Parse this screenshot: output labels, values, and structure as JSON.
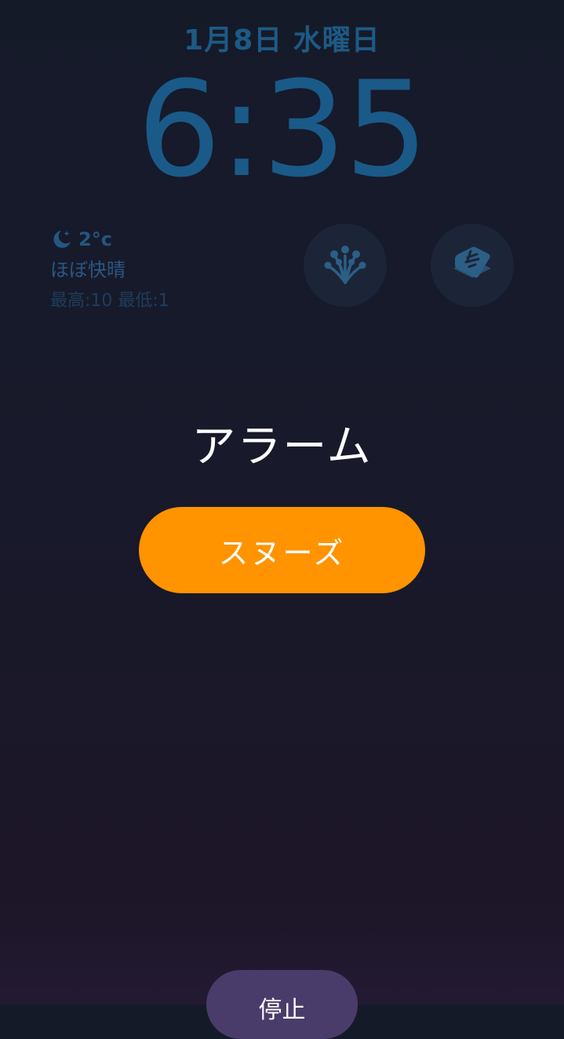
{
  "lockscreen": {
    "date": "1月8日 水曜日",
    "time": "6:35"
  },
  "weather": {
    "icon": "moon-stars-icon",
    "temperature": "2°c",
    "condition": "ほぼ快晴",
    "range": "最高:10 最低:1"
  },
  "widgets": [
    {
      "icon": "flower-app-icon"
    },
    {
      "icon": "shortcuts-app-icon"
    }
  ],
  "alarm": {
    "title": "アラーム",
    "snooze_label": "スヌーズ",
    "stop_label": "停止"
  },
  "colors": {
    "accent": "#ff9300",
    "stop_button": "#4a3c6a",
    "clock": "#1a5a88"
  }
}
